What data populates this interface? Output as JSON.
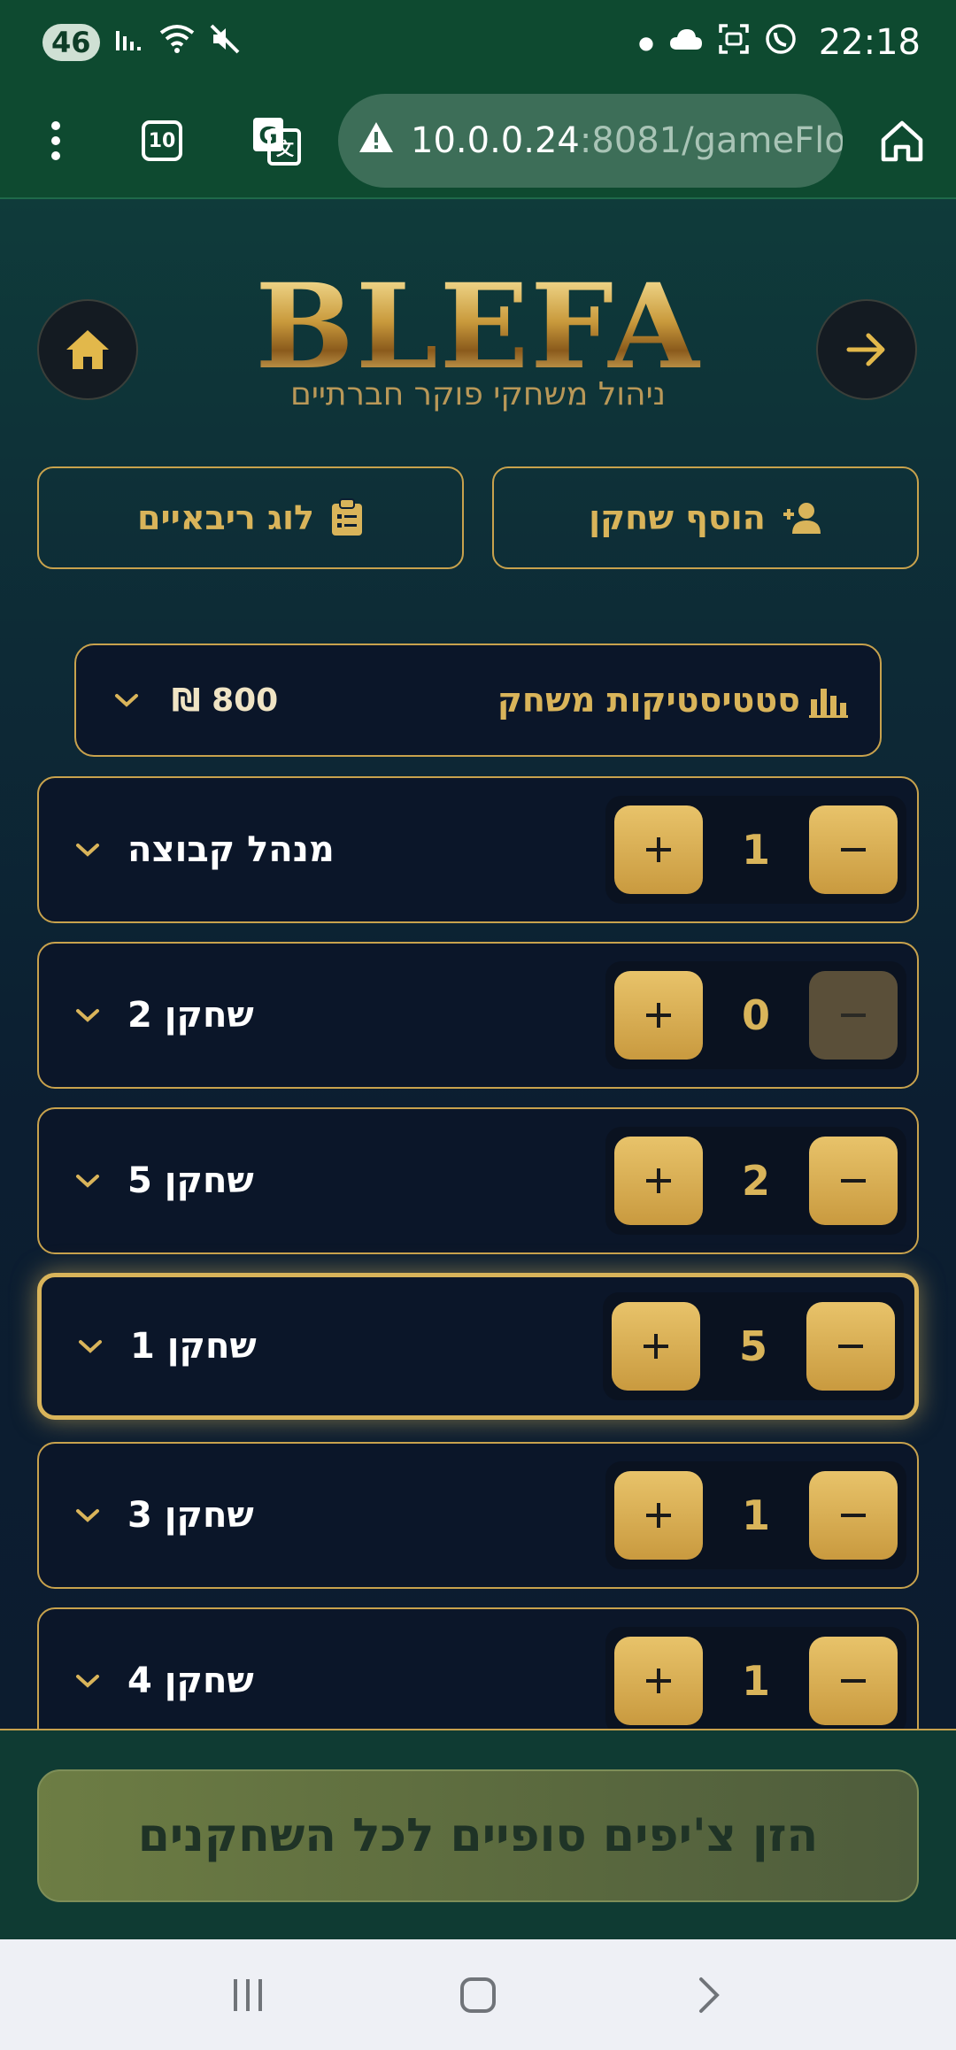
{
  "status_bar": {
    "battery": "46",
    "time": "22:18"
  },
  "browser": {
    "tab_count": "10",
    "url_host": "10.0.0.24",
    "url_rest": ":8081/gameFlow"
  },
  "header": {
    "logo": "BLEFA",
    "subtitle": "ניהול משחקי פוקר חברתיים"
  },
  "actions": {
    "add_player": "הוסף שחקן",
    "rebuy_log": "לוג ריבאיים"
  },
  "stats": {
    "title": "סטטיסטיקות משחק",
    "total": "₪ 800"
  },
  "players": [
    {
      "name": "מנהל קבוצה",
      "count": "1",
      "minus_disabled": false,
      "active": false
    },
    {
      "name": "שחקן 2",
      "count": "0",
      "minus_disabled": true,
      "active": false
    },
    {
      "name": "שחקן 5",
      "count": "2",
      "minus_disabled": false,
      "active": false
    },
    {
      "name": "שחקן 1",
      "count": "5",
      "minus_disabled": false,
      "active": true
    },
    {
      "name": "שחקן 3",
      "count": "1",
      "minus_disabled": false,
      "active": false
    },
    {
      "name": "שחקן 4",
      "count": "1",
      "minus_disabled": false,
      "active": false
    }
  ],
  "footer": {
    "final_button": "הזן צ'יפים סופיים לכל השחקנים"
  },
  "colors": {
    "gold": "#d9b45a",
    "dark_navy": "#0b1629",
    "browser_green": "#0e4a30"
  }
}
